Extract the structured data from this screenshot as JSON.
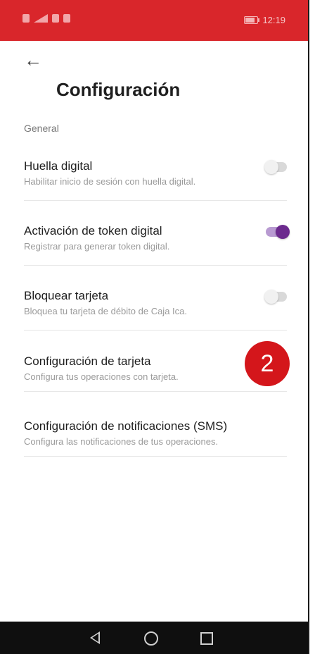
{
  "status_bar": {
    "time": "12:19"
  },
  "screen": {
    "title": "Configuración",
    "section": "General",
    "items": [
      {
        "title": "Huella digital",
        "subtitle": "Habilitar inicio de sesión con huella digital.",
        "toggle": "off"
      },
      {
        "title": "Activación de token digital",
        "subtitle": "Registrar para generar token digital.",
        "toggle": "on"
      },
      {
        "title": "Bloquear tarjeta",
        "subtitle": "Bloquea tu tarjeta de débito de Caja Ica.",
        "toggle": "off"
      },
      {
        "title": "Configuración de tarjeta",
        "subtitle": "Configura tus operaciones con tarjeta."
      },
      {
        "title": "Configuración de notificaciones (SMS)",
        "subtitle": "Configura las notificaciones de tus operaciones."
      }
    ]
  },
  "badge": {
    "value": "2",
    "color": "#d4161b"
  },
  "colors": {
    "status_bar": "#d9262b",
    "toggle_on": "#6c2a8e",
    "toggle_off": "#d9d9d9"
  },
  "icons": {
    "back": "arrow-left-icon",
    "nav_back": "triangle-back-icon",
    "nav_home": "circle-home-icon",
    "nav_recent": "square-recents-icon"
  }
}
